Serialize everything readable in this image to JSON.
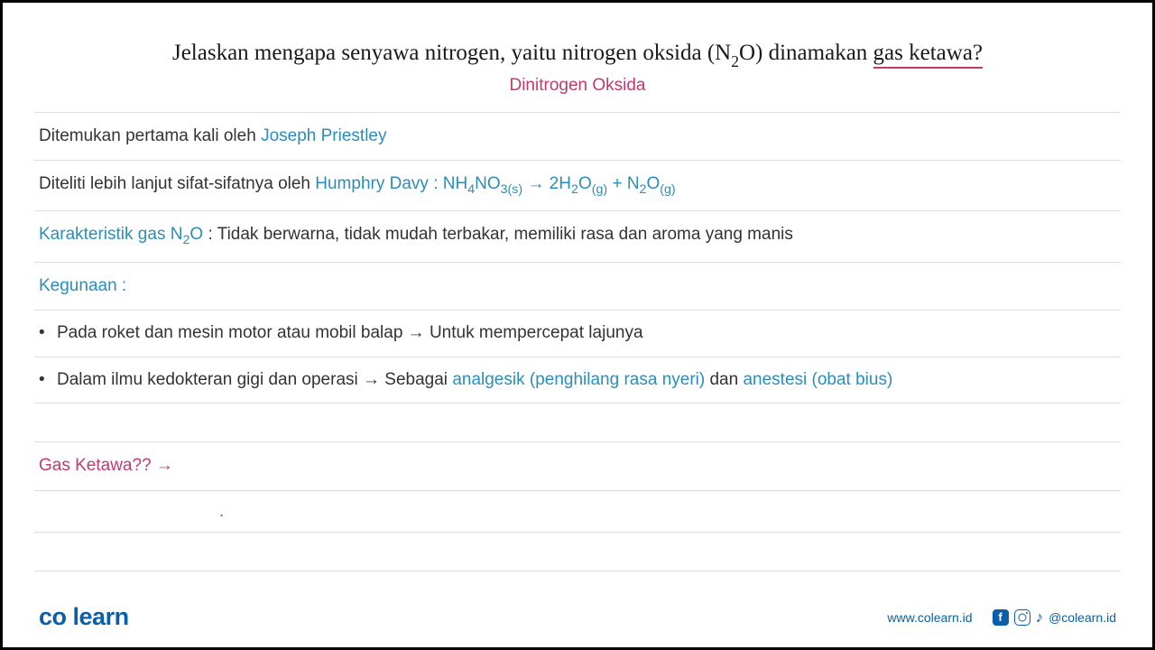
{
  "title": {
    "pre": "Jelaskan mengapa senyawa nitrogen, yaitu nitrogen oksida (N",
    "sub": "2",
    "mid": "O) dinamakan ",
    "underlined": "gas ketawa?",
    "subtitle": "Dinitrogen Oksida"
  },
  "lines": {
    "l1": {
      "text": "Ditemukan pertama kali oleh ",
      "highlight": "Joseph Priestley"
    },
    "l2": {
      "text": "Diteliti lebih lanjut sifat-sifatnya oleh ",
      "highlight": "Humphry Davy  :  NH",
      "sub1": "4",
      "mid1": "NO",
      "sub2": "3(s)",
      "arrow": " → ",
      "mid2": "2H",
      "sub3": "2",
      "mid3": "O",
      "sub4": "(g)",
      "mid4": " + N",
      "sub5": "2",
      "mid5": "O",
      "sub6": "(g)"
    },
    "l3": {
      "highlight": "Karakteristik  gas N",
      "sub": "2",
      "mid": "O",
      "text": " : Tidak berwarna, tidak mudah terbakar, memiliki rasa dan aroma yang manis"
    },
    "l4": {
      "highlight": "Kegunaan :"
    },
    "b1": {
      "text1": "Pada roket dan mesin motor atau mobil balap ",
      "arrow": "→",
      "text2": " Untuk mempercepat lajunya"
    },
    "b2": {
      "text1": "Dalam ilmu kedokteran gigi dan operasi ",
      "arrow": "→",
      "text2": " Sebagai ",
      "highlight1": "analgesik (penghilang rasa nyeri)",
      "text3": " dan ",
      "highlight2": "anestesi (obat bius)"
    },
    "question": {
      "text": "Gas Ketawa?? ",
      "arrow": "→"
    }
  },
  "footer": {
    "logo_co": "co",
    "logo_learn": "learn",
    "url": "www.colearn.id",
    "handle": "@colearn.id",
    "fb_letter": "f"
  }
}
